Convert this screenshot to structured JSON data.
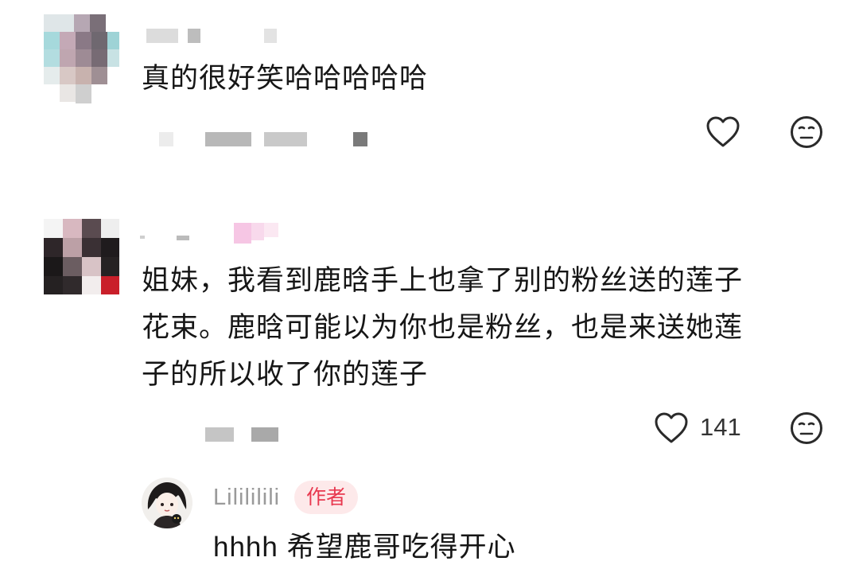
{
  "comments": [
    {
      "text": "真的很好笑哈哈哈哈哈",
      "like_count": "",
      "like_icon": "heart-outline-icon",
      "dislike_icon": "neutral-face-icon"
    },
    {
      "text_lines": [
        "姐妹，我看到鹿晗手上也拿了别的粉丝送的莲子",
        "花束。鹿晗可能以为你也是粉丝，也是来送她莲",
        "子的所以收了你的莲子"
      ],
      "like_count": "141",
      "like_icon": "heart-outline-icon",
      "dislike_icon": "neutral-face-icon"
    }
  ],
  "reply": {
    "username": "Lilililili",
    "badge": "作者",
    "text": "hhhh 希望鹿哥吃得开心"
  },
  "colors": {
    "badge_bg": "#fde9ea",
    "badge_text": "#e8384f",
    "username": "#9a9a9a"
  }
}
